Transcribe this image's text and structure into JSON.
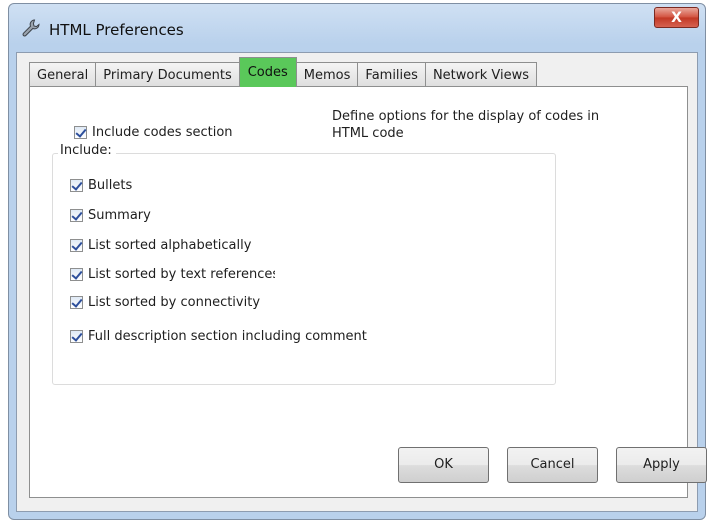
{
  "window": {
    "title": "HTML Preferences",
    "close_label": "X"
  },
  "tabs": [
    {
      "label": "General"
    },
    {
      "label": "Primary Documents"
    },
    {
      "label": "Codes",
      "active": true
    },
    {
      "label": "Memos"
    },
    {
      "label": "Families"
    },
    {
      "label": "Network Views"
    }
  ],
  "panel": {
    "include_codes_label": "Include codes section",
    "description": "Define options for the display of codes in HTML code",
    "include_group_label": "Include:",
    "options": [
      {
        "label": "Bullets",
        "checked": true
      },
      {
        "label": "Summary",
        "checked": true
      },
      {
        "label": "List sorted alphabetically",
        "checked": true
      },
      {
        "label": "List sorted by text references",
        "checked": true
      },
      {
        "label": "List sorted by connectivity",
        "checked": true
      },
      {
        "label": "Full description section including comment",
        "checked": true
      }
    ]
  },
  "buttons": {
    "ok": "OK",
    "cancel": "Cancel",
    "apply": "Apply"
  }
}
